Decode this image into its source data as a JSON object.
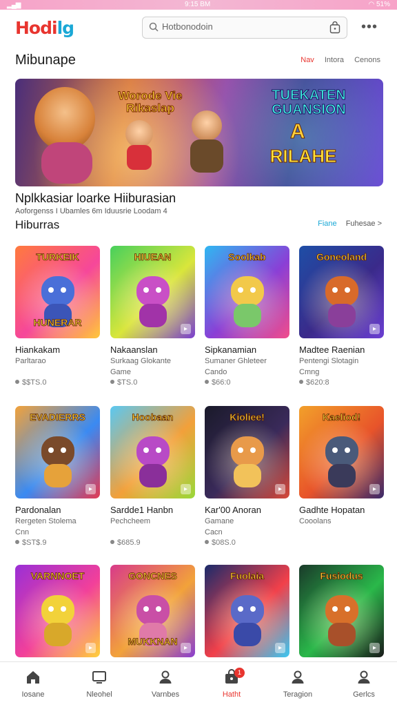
{
  "status": {
    "time": "9:15 BM",
    "battery": "51%"
  },
  "header": {
    "logo_part1": "Hodi",
    "logo_part2": "lg",
    "search_value": "Hotbonodoin",
    "more_label": "•••"
  },
  "featured": {
    "title": "Mibunape",
    "links": [
      "Nav",
      "Intora",
      "Cenons"
    ],
    "active_link": 0,
    "banner": {
      "text_left": "Worode Vie Rikaslap",
      "text_right": "TUEKATEN GUANSION",
      "text_a": "A",
      "text_bottom": "RILAHE"
    },
    "promo_title": "Nplkkasiar loarke Hiiburasian",
    "promo_subtitle": "Aoforgenss I Ubamles 6m Iduusrie Loodam 4"
  },
  "section": {
    "title": "Hiburras",
    "link_blue": "Fiane",
    "link_more": "Fuhesae >"
  },
  "games": [
    {
      "thumb_title": "TURKEIK",
      "thumb_sub": "HUNERAR",
      "name": "Hiankakam",
      "desc": [
        "Parltarao"
      ],
      "price": "$$TS.0",
      "colors": [
        "#ff7a3d",
        "#f6479a",
        "#ffc83a"
      ],
      "char": [
        "#4a6fd8",
        "#3b55b8"
      ]
    },
    {
      "thumb_title": "HIUEAN",
      "thumb_sub": "",
      "name": "Nakaanslan",
      "desc": [
        "Surkaag Glokante",
        "Game"
      ],
      "price": "$TS.0",
      "colors": [
        "#47d05c",
        "#d9e63b",
        "#7a3fd0"
      ],
      "char": [
        "#c94fc6",
        "#a133a8"
      ]
    },
    {
      "thumb_title": "Soolkab",
      "thumb_sub": "",
      "name": "Sipkanamian",
      "desc": [
        "Sumaner Ghleteer",
        "Cando"
      ],
      "price": "$66:0",
      "colors": [
        "#2fb7f2",
        "#8a3fd6",
        "#f14d8b"
      ],
      "char": [
        "#f2c94a",
        "#7ac86a"
      ]
    },
    {
      "thumb_title": "Goneoland",
      "thumb_sub": "",
      "name": "Madtee Raenian",
      "desc": [
        "Pentengi Slotagin",
        "Cmng"
      ],
      "price": "$620:8",
      "colors": [
        "#1e4ea6",
        "#3a2a8a",
        "#6b3fd2"
      ],
      "char": [
        "#d86a2a",
        "#8a3f9a"
      ]
    },
    {
      "thumb_title": "EVADIERRS",
      "thumb_sub": "",
      "name": "Pardonalan",
      "desc": [
        "Rergeten Stolema",
        "Cnn"
      ],
      "price": "$ST$.9",
      "colors": [
        "#f2a23a",
        "#3a8af2",
        "#e43a52"
      ],
      "char": [
        "#7a4a2a",
        "#e6a23a"
      ]
    },
    {
      "thumb_title": "Hoobaan",
      "thumb_sub": "",
      "name": "Sardde1 Hanbn",
      "desc": [
        "Pechcheem"
      ],
      "price": "$685.9",
      "colors": [
        "#5ac8f2",
        "#f2a03a",
        "#9ad83a"
      ],
      "char": [
        "#b84ac6",
        "#8a2f9a"
      ]
    },
    {
      "thumb_title": "Kioliee!",
      "thumb_sub": "",
      "name": "Kar'00 Anoran",
      "desc": [
        "Gamane",
        "Cacn"
      ],
      "price": "$08S.0",
      "colors": [
        "#1a1a2a",
        "#3a2a5a",
        "#d84a3a"
      ],
      "char": [
        "#e89a4a",
        "#f2c25a"
      ]
    },
    {
      "thumb_title": "Kaeliod!",
      "thumb_sub": "",
      "name": "Gadhte Hopatan",
      "desc": [
        "Cooolans"
      ],
      "price": "",
      "colors": [
        "#f2a02a",
        "#e8542a",
        "#3a2a6a"
      ],
      "char": [
        "#4a5a7a",
        "#3a3a5a"
      ]
    },
    {
      "thumb_title": "VARNNOET",
      "thumb_sub": "",
      "name": "",
      "desc": [],
      "price": "",
      "colors": [
        "#9a2fd6",
        "#f2409a",
        "#ffd23a"
      ],
      "char": [
        "#f2d23a",
        "#d8a82a"
      ]
    },
    {
      "thumb_title": "GONCNES",
      "thumb_sub": "MUKKNAN",
      "name": "",
      "desc": [],
      "price": "",
      "colors": [
        "#d83a8a",
        "#f2a23a",
        "#8a3fd0"
      ],
      "char": [
        "#c94fa6",
        "#e07aa8"
      ]
    },
    {
      "thumb_title": "Fuolaia",
      "thumb_sub": "",
      "name": "",
      "desc": [],
      "price": "",
      "colors": [
        "#1a2a6a",
        "#f2404a",
        "#3ac8f2"
      ],
      "char": [
        "#5a6ac8",
        "#3a4aa8"
      ]
    },
    {
      "thumb_title": "Fusiodus",
      "thumb_sub": "",
      "name": "",
      "desc": [],
      "price": "",
      "colors": [
        "#1a3a2a",
        "#2ab84a",
        "#1a1a1a"
      ],
      "char": [
        "#d8702a",
        "#a8502a"
      ]
    }
  ],
  "nav": [
    {
      "label": "Iosane",
      "icon": "home-icon"
    },
    {
      "label": "Nleohel",
      "icon": "screen-icon"
    },
    {
      "label": "Varnbes",
      "icon": "person-icon"
    },
    {
      "label": "Hatht",
      "icon": "bag-icon",
      "badge": "1",
      "active": true
    },
    {
      "label": "Teragion",
      "icon": "person-icon"
    },
    {
      "label": "Gerlcs",
      "icon": "person-icon"
    }
  ]
}
